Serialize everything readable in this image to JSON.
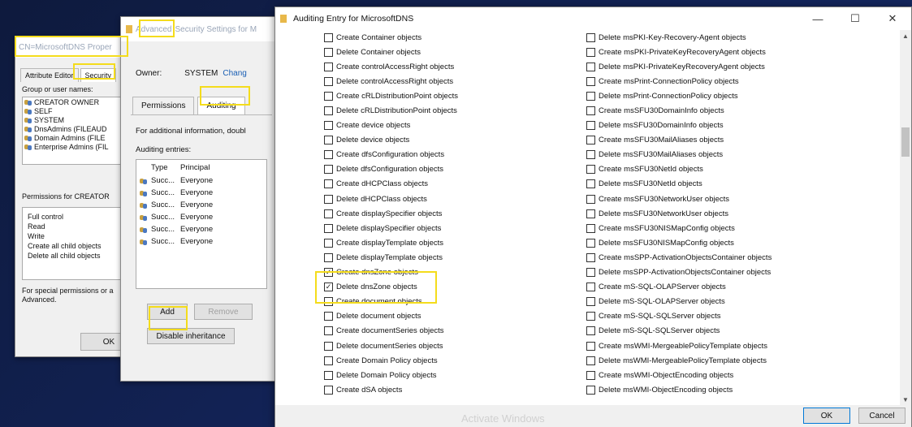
{
  "props_window": {
    "title": "CN=MicrosoftDNS Proper",
    "tabs": [
      "Attribute Editor",
      "Security"
    ],
    "group_label": "Group or user names:",
    "groups": [
      "CREATOR OWNER",
      "SELF",
      "SYSTEM",
      "DnsAdmins (FILEAUD",
      "Domain Admins (FILE",
      "Enterprise Admins (FIL"
    ],
    "permissions_label": "Permissions for CREATOR",
    "permissions": [
      "Full control",
      "Read",
      "Write",
      "Create all child objects",
      "Delete all child objects"
    ],
    "note_line1": "For special permissions or a",
    "note_line2": "Advanced.",
    "ok_label": "OK"
  },
  "advanced_window": {
    "title_prefix": "Advanced",
    "title_rest": " Security Settings for M",
    "owner_label": "Owner:",
    "owner_value": "SYSTEM",
    "owner_link": "Chang",
    "tabs": [
      "Permissions",
      "Auditing"
    ],
    "info": "For additional information, doubl",
    "entries_label": "Auditing entries:",
    "columns": [
      "Type",
      "Principal"
    ],
    "entries": [
      {
        "type": "Succ...",
        "principal": "Everyone"
      },
      {
        "type": "Succ...",
        "principal": "Everyone"
      },
      {
        "type": "Succ...",
        "principal": "Everyone"
      },
      {
        "type": "Succ...",
        "principal": "Everyone"
      },
      {
        "type": "Succ...",
        "principal": "Everyone"
      },
      {
        "type": "Succ...",
        "principal": "Everyone"
      }
    ],
    "add_label": "Add",
    "remove_label": "Remove",
    "disable_label": "Disable inheritance"
  },
  "audit_window": {
    "title": "Auditing Entry for MicrosoftDNS",
    "minimize": "—",
    "maximize": "☐",
    "close": "✕",
    "left_column": [
      {
        "label": "Create Container objects",
        "checked": false
      },
      {
        "label": "Delete Container objects",
        "checked": false
      },
      {
        "label": "Create controlAccessRight objects",
        "checked": false
      },
      {
        "label": "Delete controlAccessRight objects",
        "checked": false
      },
      {
        "label": "Create cRLDistributionPoint objects",
        "checked": false
      },
      {
        "label": "Delete cRLDistributionPoint objects",
        "checked": false
      },
      {
        "label": "Create device objects",
        "checked": false
      },
      {
        "label": "Delete device objects",
        "checked": false
      },
      {
        "label": "Create dfsConfiguration objects",
        "checked": false
      },
      {
        "label": "Delete dfsConfiguration objects",
        "checked": false
      },
      {
        "label": "Create dHCPClass objects",
        "checked": false
      },
      {
        "label": "Delete dHCPClass objects",
        "checked": false
      },
      {
        "label": "Create displaySpecifier objects",
        "checked": false
      },
      {
        "label": "Delete displaySpecifier objects",
        "checked": false
      },
      {
        "label": "Create displayTemplate objects",
        "checked": false
      },
      {
        "label": "Delete displayTemplate objects",
        "checked": false
      },
      {
        "label": "Create dnsZone objects",
        "checked": true
      },
      {
        "label": "Delete dnsZone objects",
        "checked": true
      },
      {
        "label": "Create document objects",
        "checked": false
      },
      {
        "label": "Delete document objects",
        "checked": false
      },
      {
        "label": "Create documentSeries objects",
        "checked": false
      },
      {
        "label": "Delete documentSeries objects",
        "checked": false
      },
      {
        "label": "Create Domain Policy objects",
        "checked": false
      },
      {
        "label": "Delete Domain Policy objects",
        "checked": false
      },
      {
        "label": "Create dSA objects",
        "checked": false
      }
    ],
    "right_column": [
      {
        "label": "Delete msPKI-Key-Recovery-Agent objects",
        "checked": false
      },
      {
        "label": "Create msPKI-PrivateKeyRecoveryAgent objects",
        "checked": false
      },
      {
        "label": "Delete msPKI-PrivateKeyRecoveryAgent objects",
        "checked": false
      },
      {
        "label": "Create msPrint-ConnectionPolicy objects",
        "checked": false
      },
      {
        "label": "Delete msPrint-ConnectionPolicy objects",
        "checked": false
      },
      {
        "label": "Create msSFU30DomainInfo objects",
        "checked": false
      },
      {
        "label": "Delete msSFU30DomainInfo objects",
        "checked": false
      },
      {
        "label": "Create msSFU30MailAliases objects",
        "checked": false
      },
      {
        "label": "Delete msSFU30MailAliases objects",
        "checked": false
      },
      {
        "label": "Create msSFU30NetId objects",
        "checked": false
      },
      {
        "label": "Delete msSFU30NetId objects",
        "checked": false
      },
      {
        "label": "Create msSFU30NetworkUser objects",
        "checked": false
      },
      {
        "label": "Delete msSFU30NetworkUser objects",
        "checked": false
      },
      {
        "label": "Create msSFU30NISMapConfig objects",
        "checked": false
      },
      {
        "label": "Delete msSFU30NISMapConfig objects",
        "checked": false
      },
      {
        "label": "Create msSPP-ActivationObjectsContainer objects",
        "checked": false
      },
      {
        "label": "Delete msSPP-ActivationObjectsContainer objects",
        "checked": false
      },
      {
        "label": "Create mS-SQL-OLAPServer objects",
        "checked": false
      },
      {
        "label": "Delete mS-SQL-OLAPServer objects",
        "checked": false
      },
      {
        "label": "Create mS-SQL-SQLServer objects",
        "checked": false
      },
      {
        "label": "Delete mS-SQL-SQLServer objects",
        "checked": false
      },
      {
        "label": "Create msWMI-MergeablePolicyTemplate objects",
        "checked": false
      },
      {
        "label": "Delete msWMI-MergeablePolicyTemplate objects",
        "checked": false
      },
      {
        "label": "Create msWMI-ObjectEncoding objects",
        "checked": false
      },
      {
        "label": "Delete msWMI-ObjectEncoding objects",
        "checked": false
      }
    ],
    "ok_label": "OK",
    "cancel_label": "Cancel",
    "watermark": "Activate Windows"
  },
  "colors": {
    "highlight": "#f4dc1c",
    "link": "#1a5fb4",
    "desktop": "#0f1b3a"
  }
}
